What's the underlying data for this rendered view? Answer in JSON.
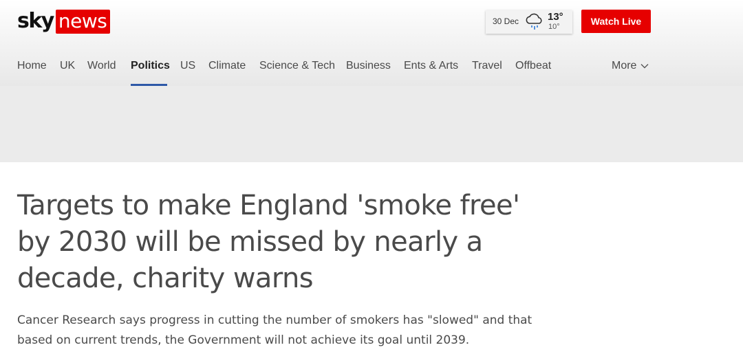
{
  "brand": {
    "sky": "sky",
    "news": "news"
  },
  "weather": {
    "date": "30 Dec",
    "high": "13°",
    "low": "10°",
    "icon": "rain-cloud-icon"
  },
  "header": {
    "watch_live": "Watch Live"
  },
  "nav": {
    "items": [
      {
        "label": "Home"
      },
      {
        "label": "UK"
      },
      {
        "label": "World"
      },
      {
        "label": "Politics",
        "active": true
      },
      {
        "label": "US"
      },
      {
        "label": "Climate"
      },
      {
        "label": "Science & Tech"
      },
      {
        "label": "Business"
      },
      {
        "label": "Ents & Arts"
      },
      {
        "label": "Travel"
      },
      {
        "label": "Offbeat"
      }
    ],
    "more": "More"
  },
  "article": {
    "headline": "Targets to make England 'smoke free' by 2030 will be missed by nearly a decade, charity warns",
    "standfirst": "Cancer Research says progress in cutting the number of smokers has \"slowed\" and that based on current trends, the Government will not achieve its goal until 2039."
  },
  "colors": {
    "brand_red": "#e60000",
    "active_underline": "#2d58a7"
  }
}
